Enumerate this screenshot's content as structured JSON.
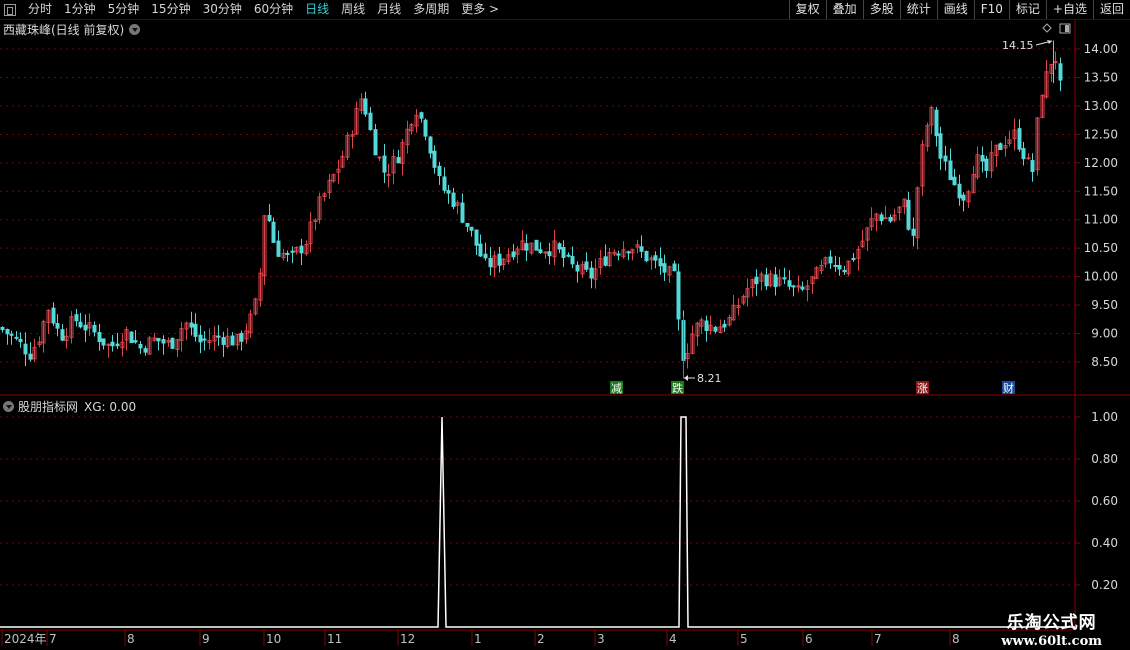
{
  "toolbar": {
    "left_items": [
      "分时",
      "1分钟",
      "5分钟",
      "15分钟",
      "30分钟",
      "60分钟",
      "日线",
      "周线",
      "月线",
      "多周期",
      "更多 >"
    ],
    "active": "日线",
    "right_items": [
      "复权",
      "叠加",
      "多股",
      "统计",
      "画线",
      "F10",
      "标记",
      "+自选",
      "返回"
    ]
  },
  "main_chart": {
    "title": "西藏珠峰(日线 前复权)",
    "price_axis": [
      "14.00",
      "13.50",
      "13.00",
      "12.50",
      "12.00",
      "11.50",
      "11.00",
      "10.50",
      "10.00",
      "9.50",
      "9.00",
      "8.50"
    ],
    "high_label": "14.15",
    "low_label": "8.21",
    "markers": [
      {
        "text": "减",
        "color": "#1a7a1a"
      },
      {
        "text": "跌",
        "color": "#1a7a1a"
      },
      {
        "text": "涨",
        "color": "#8a1a1a"
      },
      {
        "text": "财",
        "color": "#1a4a9a"
      }
    ]
  },
  "indicator": {
    "title": "股朋指标网",
    "value_label": "XG: 0.00",
    "axis": [
      "1.00",
      "0.80",
      "0.60",
      "0.40",
      "0.20"
    ]
  },
  "date_axis": [
    "2024年",
    "7",
    "8",
    "9",
    "10",
    "11",
    "12",
    "1",
    "2",
    "3",
    "4",
    "5",
    "6",
    "7",
    "8"
  ],
  "watermark": {
    "line1": "乐淘公式网",
    "line2": "www.60lt.com"
  }
}
